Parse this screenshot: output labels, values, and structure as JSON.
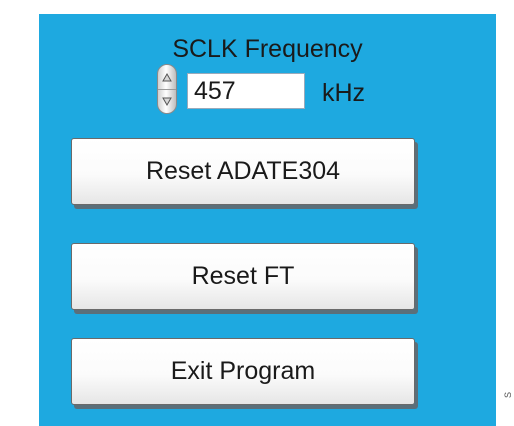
{
  "sclk": {
    "title": "SCLK Frequency",
    "value": "457",
    "unit": "kHz",
    "spinner": {
      "up_icon": "triangle-up-icon",
      "down_icon": "triangle-down-icon"
    }
  },
  "buttons": {
    "reset_adate304": "Reset ADATE304",
    "reset_ft": "Reset FT",
    "exit_program": "Exit Program"
  },
  "side_mark": "S",
  "colors": {
    "panel_background": "#1ea9e0",
    "button_face": "#ffffff",
    "button_shadow": "#5b6f7a"
  }
}
